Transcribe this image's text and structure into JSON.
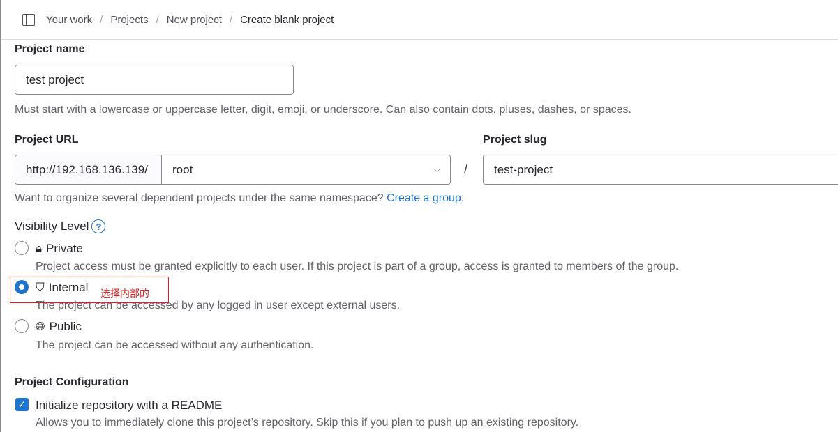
{
  "breadcrumb": [
    "Your work",
    "Projects",
    "New project",
    "Create blank project"
  ],
  "project_name": {
    "label": "Project name",
    "value": "test project",
    "help": "Must start with a lowercase or uppercase letter, digit, emoji, or underscore. Can also contain dots, pluses, dashes, or spaces."
  },
  "project_url": {
    "label": "Project URL",
    "prefix": "http://192.168.136.139/",
    "namespace": "root",
    "separator": "/"
  },
  "project_slug": {
    "label": "Project slug",
    "value": "test-project"
  },
  "namespace_help": {
    "text": "Want to organize several dependent projects under the same namespace?",
    "link": "Create a group."
  },
  "visibility": {
    "label": "Visibility Level",
    "options": [
      {
        "label": "Private",
        "desc": "Project access must be granted explicitly to each user. If this project is part of a group, access is granted to members of the group.",
        "selected": false,
        "icon": "lock-icon"
      },
      {
        "label": "Internal",
        "desc": "The project can be accessed by any logged in user except external users.",
        "selected": true,
        "icon": "shield-icon"
      },
      {
        "label": "Public",
        "desc": "The project can be accessed without any authentication.",
        "selected": false,
        "icon": "globe-icon"
      }
    ]
  },
  "annotation": {
    "text": "选择内部的",
    "color": "#e02020"
  },
  "config": {
    "label": "Project Configuration",
    "readme_label": "Initialize repository with a README",
    "readme_checked": true,
    "readme_help": "Allows you to immediately clone this project’s repository. Skip this if you plan to push up an existing repository."
  }
}
